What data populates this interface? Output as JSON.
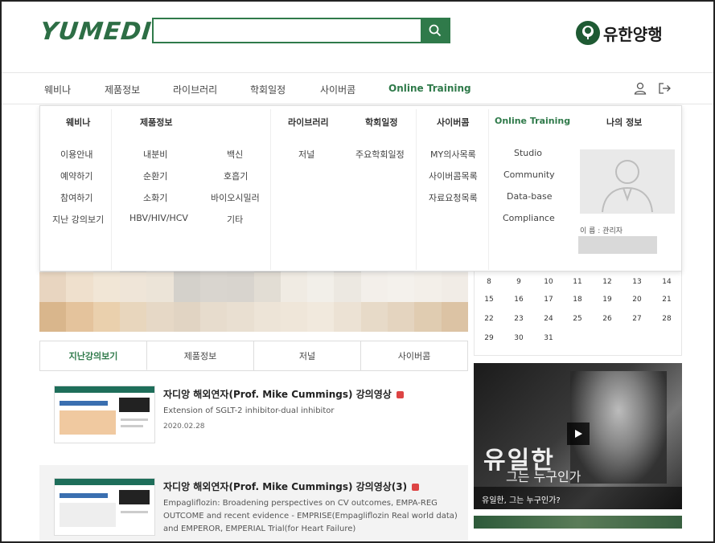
{
  "header": {
    "logo": "YUMEDI",
    "search_placeholder": "",
    "brand": "유한양행"
  },
  "nav": {
    "items": [
      "웨비나",
      "제품정보",
      "라이브러리",
      "학회일정",
      "사이버콤",
      "Online Training"
    ],
    "active": "Online Training",
    "icons": [
      "user-icon",
      "logout-icon"
    ]
  },
  "mega_menu": {
    "heads": [
      "웨비나",
      "제품정보",
      "라이브러리",
      "학회일정",
      "사이버콤",
      "Online Training",
      "나의 정보"
    ],
    "webinar": [
      "이용안내",
      "예약하기",
      "참여하기",
      "지난 강의보기"
    ],
    "product_col1": [
      "내분비",
      "순환기",
      "소화기",
      "HBV/HIV/HCV"
    ],
    "product_col2": [
      "백신",
      "호흡기",
      "바이오시밀러",
      "기타"
    ],
    "library": [
      "저널"
    ],
    "conference": [
      "주요학회일정"
    ],
    "cybercom": [
      "MY의사목록",
      "사이버콤목록",
      "자료요청목록"
    ],
    "online_training": [
      "Studio",
      "Community",
      "Data-base",
      "Compliance"
    ],
    "profile_name": "이 름 : 관리자"
  },
  "calendar": {
    "rows": [
      [
        "8",
        "9",
        "10",
        "11",
        "12",
        "13",
        "14"
      ],
      [
        "15",
        "16",
        "17",
        "18",
        "19",
        "20",
        "21"
      ],
      [
        "22",
        "23",
        "24",
        "25",
        "26",
        "27",
        "28"
      ],
      [
        "29",
        "30",
        "31",
        "",
        "",
        "",
        ""
      ]
    ]
  },
  "tabs": [
    "지난강의보기",
    "제품정보",
    "저널",
    "사이버콤"
  ],
  "active_tab": "지난강의보기",
  "lectures": [
    {
      "title": "자디앙 해외연자(Prof. Mike Cummings) 강의영상",
      "desc": "Extension of SGLT-2 inhibitor-dual inhibitor",
      "date": "2020.02.28"
    },
    {
      "title": "자디앙 해외연자(Prof. Mike Cummings) 강의영상(3)",
      "desc": "Empagliflozin: Broadening perspectives on CV outcomes, EMPA-REG OUTCOME and recent evidence - EMPRISE(Empagliflozin Real world data) and EMPEROR, EMPERIAL Trial(for Heart Failure)",
      "date": ""
    }
  ],
  "video": {
    "big_title": "유일한",
    "sub_title": "그는 누구인가",
    "caption": "유일한, 그는 누구인가?"
  },
  "colors": {
    "brand_green": "#2f7a4a",
    "text": "#333333"
  }
}
